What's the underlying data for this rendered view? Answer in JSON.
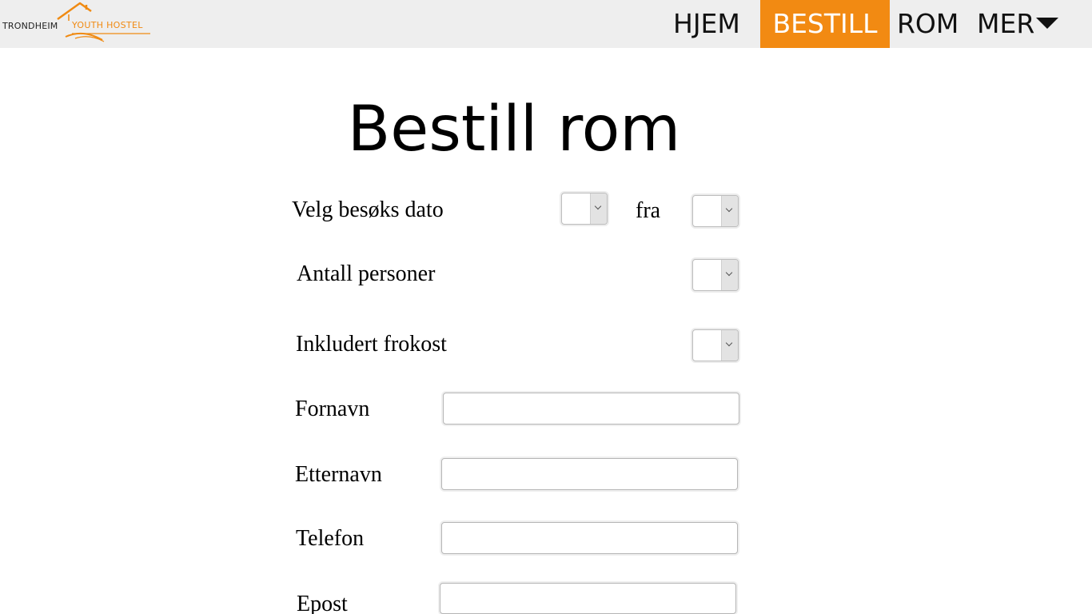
{
  "logo": {
    "name_part_1": "TRONDHEIM",
    "name_part_2": "YOUTH HOSTEL",
    "icon": "house-roof-icon",
    "accent_color": "#f08a12"
  },
  "nav": {
    "items": [
      {
        "label": "HJEM",
        "active": false
      },
      {
        "label": "BESTILL",
        "active": true
      },
      {
        "label": "ROM",
        "active": false
      },
      {
        "label": "MER",
        "active": false,
        "icon": "caret-down-icon"
      }
    ],
    "active_color": "#f28a12",
    "bar_color": "#eeeeee"
  },
  "page": {
    "title": "Bestill rom"
  },
  "form": {
    "visit_date_label": "Velg besøks dato",
    "visit_date_value": "",
    "from_label": "fra",
    "from_value": "",
    "persons_label": "Antall personer",
    "persons_value": "",
    "breakfast_label": "Inkludert frokost",
    "breakfast_value": "",
    "first_name_label": "Fornavn",
    "first_name_value": "",
    "last_name_label": "Etternavn",
    "last_name_value": "",
    "phone_label": "Telefon",
    "phone_value": "",
    "email_label": "Epost",
    "email_value": ""
  }
}
